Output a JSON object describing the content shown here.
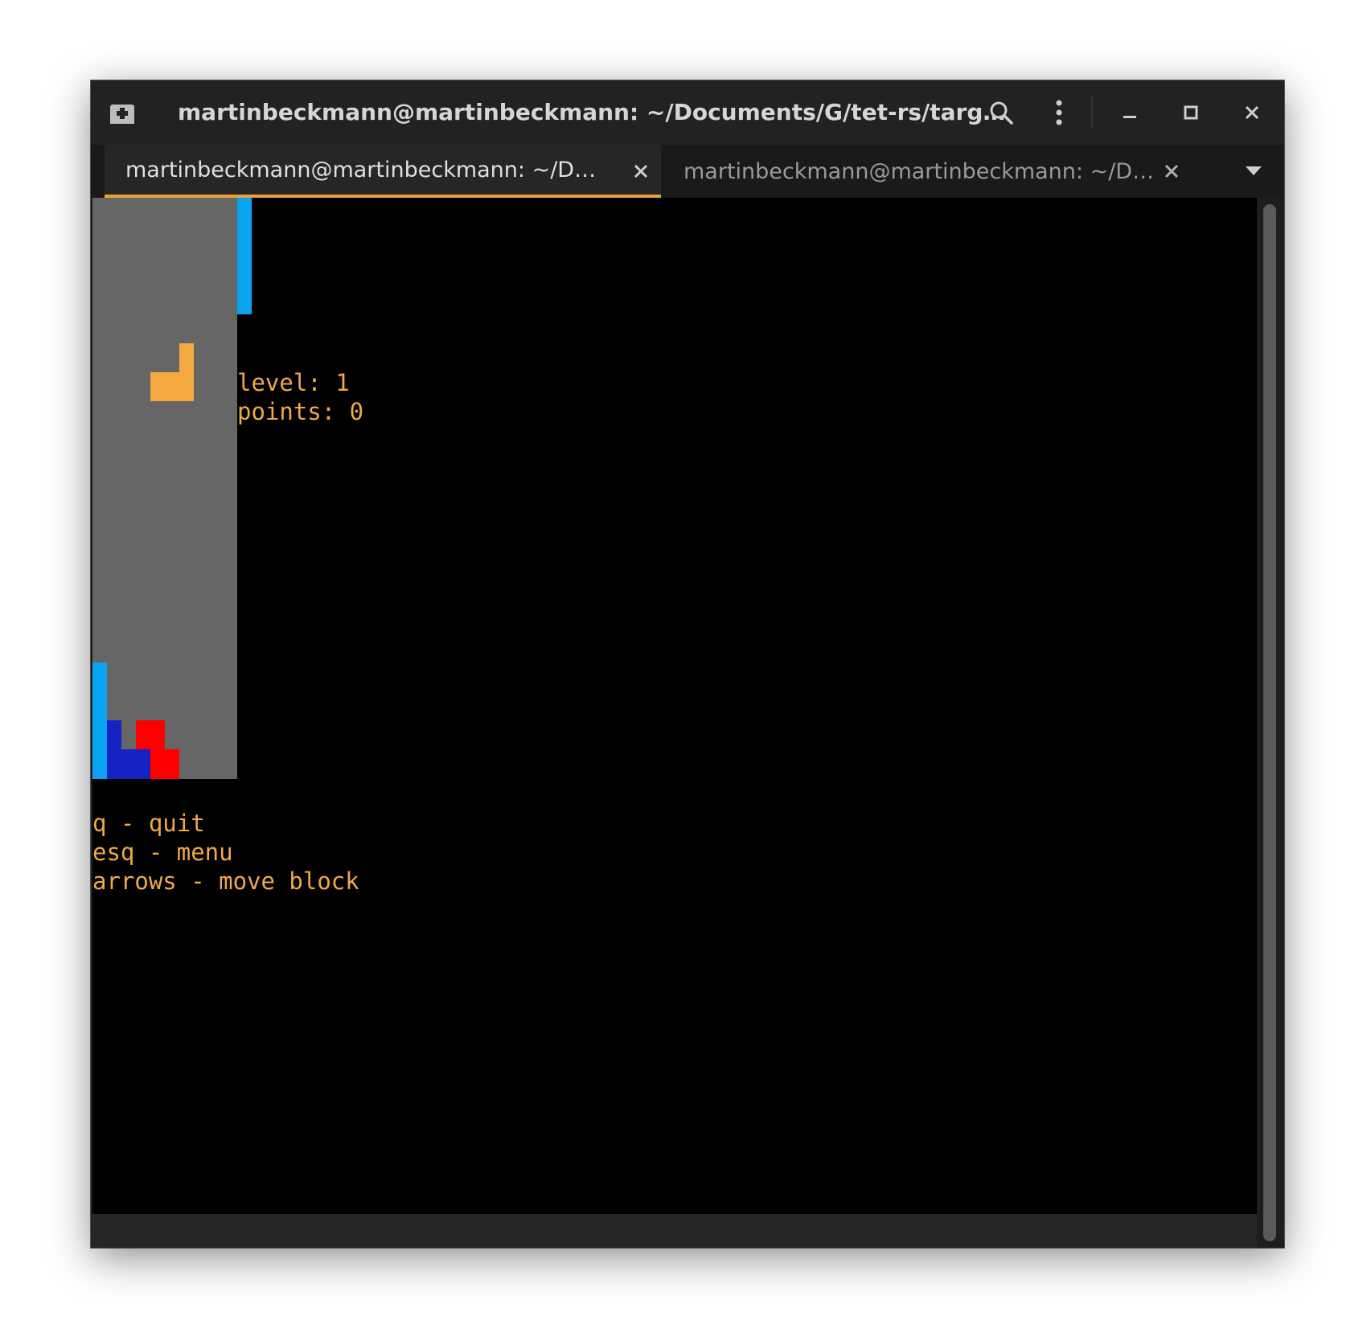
{
  "window": {
    "title": "martinbeckmann@martinbeckmann: ~/Documents/G/tet-rs/targ…"
  },
  "tabs": [
    {
      "label": "martinbeckmann@martinbeckmann: ~/D…",
      "active": true
    },
    {
      "label": "martinbeckmann@martinbeckmann: ~/D…",
      "active": false
    }
  ],
  "icons": {
    "new_tab": "new-tab-icon",
    "search": "search-icon",
    "menu": "kebab-menu-icon",
    "minimize": "minimize-icon",
    "maximize": "maximize-icon",
    "close": "close-icon",
    "tab_close": "close-icon",
    "tab_list": "chevron-down-icon"
  },
  "game": {
    "level_text": "level: 1",
    "points_text": "points: 0",
    "help": [
      "q - quit",
      "esq - menu",
      "arrows - move block"
    ]
  },
  "colors": {
    "accent": "#e8a13c",
    "text": "#f0a848",
    "board": "#666666",
    "cyan": "#0aa4f0",
    "orange": "#f4a840",
    "blue": "#1722c4",
    "red": "#ff0000",
    "terminal_bg": "#000000"
  }
}
